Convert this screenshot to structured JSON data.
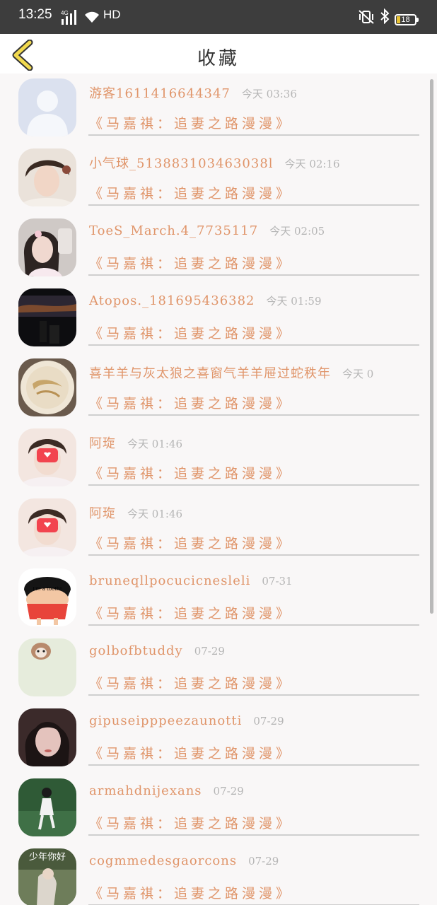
{
  "status_bar": {
    "time": "13:25",
    "network": "4G",
    "hd": "HD",
    "battery": "18"
  },
  "header": {
    "title": "收藏",
    "back_icon": "chevron-left-icon"
  },
  "colors": {
    "accent": "#e0956a",
    "time_gray": "#b5b5b5",
    "back_yellow": "#f1d94e"
  },
  "items": [
    {
      "username": "游客1611416644347",
      "time": "今天 03:36",
      "work": "《马嘉祺：追妻之路漫漫》",
      "avatar": "default-avatar"
    },
    {
      "username": "小气球_513883103463038l",
      "time": "今天 02:16",
      "work": "《马嘉祺：追妻之路漫漫》",
      "avatar": "photo-avatar"
    },
    {
      "username": "ToeS_March.4_7735117",
      "time": "今天 02:05",
      "work": "《马嘉祺：追妻之路漫漫》",
      "avatar": "photo-avatar"
    },
    {
      "username": "Atopos._181695436382",
      "time": "今天 01:59",
      "work": "《马嘉祺：追妻之路漫漫》",
      "avatar": "photo-avatar"
    },
    {
      "username": "喜羊羊与灰太狼之喜窗气羊羊屉过蛇秩年",
      "time": "今天 0",
      "work": "《马嘉祺：追妻之路漫漫》",
      "avatar": "photo-avatar"
    },
    {
      "username": "阿琁",
      "time": "今天 01:46",
      "work": "《马嘉祺：追妻之路漫漫》",
      "avatar": "photo-avatar"
    },
    {
      "username": "阿琁",
      "time": "今天 01:46",
      "work": "《马嘉祺：追妻之路漫漫》",
      "avatar": "photo-avatar"
    },
    {
      "username": "bruneqllpocucicnesleli",
      "time": "07-31",
      "work": "《马嘉祺：追妻之路漫漫》",
      "avatar": "cartoon-avatar",
      "avatar_text": "I'm a tooth!"
    },
    {
      "username": "golbofbtuddy",
      "time": "07-29",
      "work": "《马嘉祺：追妻之路漫漫》",
      "avatar": "photo-avatar"
    },
    {
      "username": "gipuseipppeezaunotti",
      "time": "07-29",
      "work": "《马嘉祺：追妻之路漫漫》",
      "avatar": "photo-avatar"
    },
    {
      "username": "armahdnijexans",
      "time": "07-29",
      "work": "《马嘉祺：追妻之路漫漫》",
      "avatar": "photo-avatar"
    },
    {
      "username": "cogmmedesgaorcons",
      "time": "07-29",
      "work": "《马嘉祺：追妻之路漫漫》",
      "avatar": "photo-avatar",
      "avatar_text": "少年你好"
    }
  ]
}
